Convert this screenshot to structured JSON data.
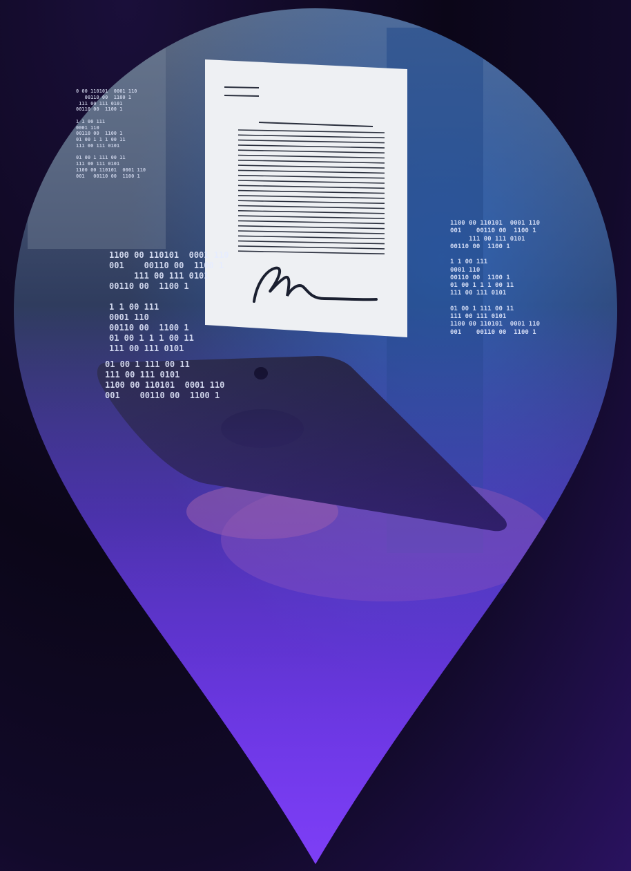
{
  "image": {
    "subject": "hand holding smartphone with floating signed document inside a map-pin shaped frame",
    "colors": {
      "background": "#0b0618",
      "accent": "#7a3cf0",
      "paper": "#eef0f3",
      "ink": "#1b2030"
    }
  },
  "binary_streams": {
    "top_left": "0 00 110101  0001 110\n   00110 00  1100 1\n 111 00 111 0101\n00110 00  1100 1\n\n1 1 00 111\n0001 110\n00110 00  1100 1\n01 00 1 1 1 00 11\n111 00 111 0101\n\n01 00 1 111 00 11\n111 00 111 0101\n1100 00 110101  0001 110\n001   00110 00  1100 1",
    "middle_left": "1100 00 110101  0001 110\n001    00110 00  1100 1\n     111 00 111 0101\n00110 00  1100 1\n\n1 1 00 111\n0001 110\n00110 00  1100 1\n01 00 1 1 1 00 11\n111 00 111 0101",
    "lower_left": "01 00 1 111 00 11\n111 00 111 0101\n1100 00 110101  0001 110\n001    00110 00  1100 1",
    "right": "1100 00 110101  0001 110\n001    00110 00  1100 1\n     111 00 111 0101\n00110 00  1100 1\n\n1 1 00 111\n0001 110\n00110 00  1100 1\n01 00 1 1 1 00 11\n111 00 111 0101\n\n01 00 1 111 00 11\n111 00 111 0101\n1100 00 110101  0001 110\n001    00110 00  1100 1"
  }
}
